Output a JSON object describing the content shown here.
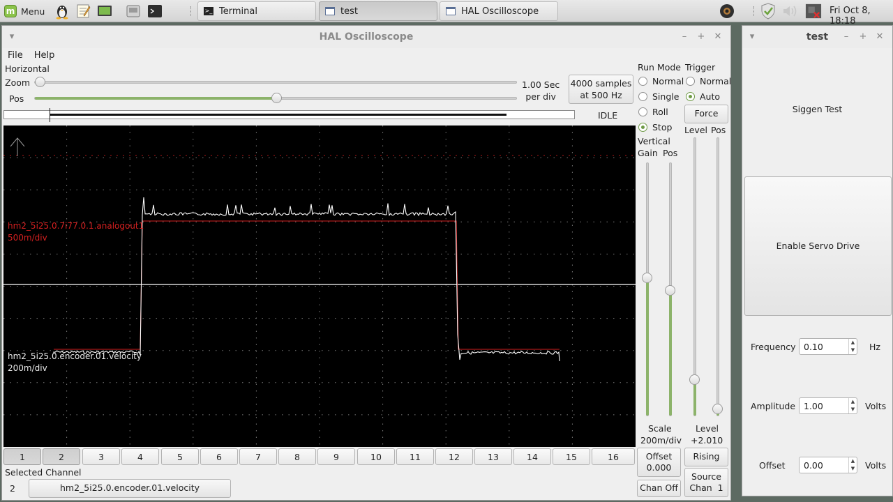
{
  "panel": {
    "menu_label": "Menu",
    "tasks": [
      {
        "label": "Terminal",
        "icon": "terminal-icon"
      },
      {
        "label": "test",
        "icon": "window-icon"
      },
      {
        "label": "HAL Oscilloscope",
        "icon": "window-icon"
      }
    ],
    "clock": "Fri Oct  8, 18:18"
  },
  "scope": {
    "title": "HAL Oscilloscope",
    "menu": [
      "File",
      "Help"
    ],
    "horizontal": {
      "heading": "Horizontal",
      "zoom_label": "Zoom",
      "pos_label": "Pos",
      "zoom_level": 0.0,
      "pos_level": 0.5,
      "timebase": "1.00 Sec\nper div",
      "samples_btn": "4000 samples\nat 500 Hz",
      "state": "IDLE"
    },
    "run_mode": {
      "heading": "Run Mode",
      "options": [
        "Normal",
        "Single",
        "Roll",
        "Stop"
      ],
      "selected": "Stop"
    },
    "trigger": {
      "heading": "Trigger",
      "options": [
        "Normal",
        "Auto"
      ],
      "selected": "Auto",
      "force_label": "Force",
      "level_label": "Level",
      "pos_label": "Pos",
      "level_value": 0.88,
      "pos_value": 0.99,
      "level_readout_label": "Level",
      "level_readout_value": "+2.010",
      "edge_btn": "Rising",
      "source_btn": "Source\nChan  1"
    },
    "vertical": {
      "heading": "Vertical",
      "gain_label": "Gain",
      "pos_label": "Pos",
      "gain_value": 0.45,
      "pos_value": 0.5,
      "scale_label": "Scale",
      "scale_value": "200m/div",
      "offset_btn": "Offset\n0.000",
      "chan_off_btn": "Chan Off"
    },
    "traces": [
      {
        "name": "hm2_5i25.0.7i77.0.1.analogout1",
        "scale": "500m/div",
        "color": "#d42020"
      },
      {
        "name": "hm2_5i25.0.encoder.01.velocity",
        "scale": "200m/div",
        "color": "#ffffff"
      }
    ],
    "channels": [
      "1",
      "2",
      "3",
      "4",
      "5",
      "6",
      "7",
      "8",
      "9",
      "10",
      "11",
      "12",
      "13",
      "14",
      "15",
      "16"
    ],
    "selected_channels": [
      "1",
      "2"
    ],
    "selected_channel_label": "Selected Channel",
    "selected_channel_number": "2",
    "selected_channel_name": "hm2_5i25.0.encoder.01.velocity"
  },
  "test": {
    "title": "test",
    "siggen_label": "Siggen Test",
    "enable_btn": "Enable Servo Drive",
    "params": [
      {
        "label": "Frequency",
        "value": "0.10",
        "unit": "Hz"
      },
      {
        "label": "Amplitude",
        "value": "1.00",
        "unit": "Volts"
      },
      {
        "label": "Offset",
        "value": "0.00",
        "unit": "Volts"
      }
    ]
  },
  "colors": {
    "accent": "#8cb36a",
    "scope_bg": "#000000",
    "grid": "#7a7a7a"
  }
}
